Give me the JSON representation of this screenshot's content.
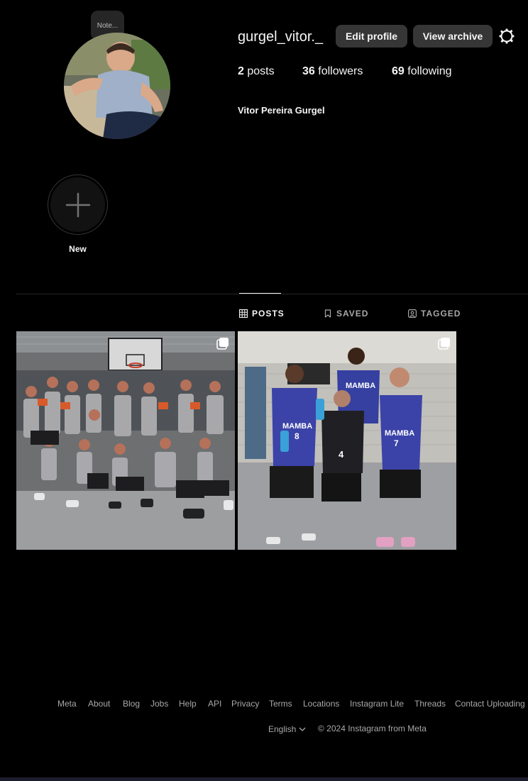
{
  "profile": {
    "note_label": "Note...",
    "username": "gurgel_vitor._",
    "edit_profile": "Edit profile",
    "view_archive": "View archive",
    "full_name": "Vitor Pereira Gurgel",
    "stats": {
      "posts_count": "2",
      "posts_label": "posts",
      "followers_count": "36",
      "followers_label": "followers",
      "following_count": "69",
      "following_label": "following"
    }
  },
  "highlights": {
    "new_label": "New"
  },
  "tabs": {
    "posts": "POSTS",
    "saved": "SAVED",
    "tagged": "TAGGED"
  },
  "footer": {
    "links": [
      "Meta",
      "About",
      "Blog",
      "Jobs",
      "Help",
      "API",
      "Privacy",
      "Terms",
      "Locations",
      "Instagram Lite",
      "Threads",
      "Contact Uploading"
    ],
    "language": "English",
    "copyright": "© 2024 Instagram from Meta"
  },
  "colors": {
    "background": "#000000",
    "button": "#363636",
    "muted_text": "#a8a8a8",
    "divider": "#262626"
  },
  "icons": {
    "settings": "gear-icon",
    "new_highlight": "plus-icon",
    "posts_tab": "grid-icon",
    "saved_tab": "bookmark-icon",
    "tagged_tab": "tag-user-icon",
    "multi_post": "carousel-icon",
    "language": "chevron-down-icon"
  }
}
